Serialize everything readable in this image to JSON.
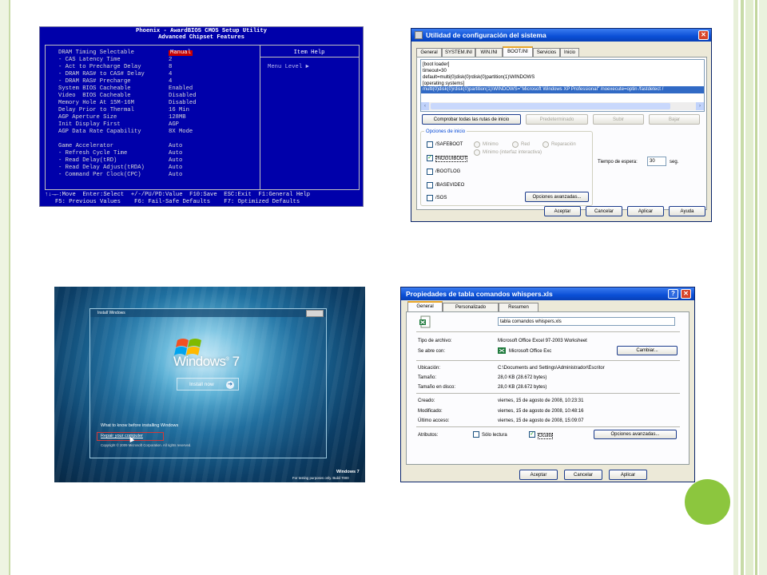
{
  "bios": {
    "title_line1": "Phoenix - AwardBIOS CMOS Setup Utility",
    "title_line2": "Advanced Chipset Features",
    "item_help_title": "Item Help",
    "menu_level": "Menu Level   ►",
    "rows": [
      {
        "label": "DRAM Timing Selectable",
        "value": "Manual"
      },
      {
        "label": "- CAS Latency Time",
        "value": "2"
      },
      {
        "label": "- Act to Precharge Delay",
        "value": "8"
      },
      {
        "label": "- DRAM RAS# to CAS# Delay",
        "value": "4"
      },
      {
        "label": "- DRAM RAS# Precharge",
        "value": "4"
      },
      {
        "label": "System BIOS Cacheable",
        "value": "Enabled"
      },
      {
        "label": "Video  BIOS Cacheable",
        "value": "Disabled"
      },
      {
        "label": "Memory Hole At 15M-16M",
        "value": "Disabled"
      },
      {
        "label": "Delay Prior to Thermal",
        "value": "16 Min"
      },
      {
        "label": "AGP Aperture Size",
        "value": "128MB"
      },
      {
        "label": "Init Display First",
        "value": "AGP"
      },
      {
        "label": "AGP Data Rate Capability",
        "value": "8X Mode"
      },
      {
        "label": "Game Accelerator",
        "value": "Auto"
      },
      {
        "label": "- Refresh Cycle Time",
        "value": "Auto"
      },
      {
        "label": "- Read Delay(tRD)",
        "value": "Auto"
      },
      {
        "label": "- Read Delay Adjust(tRDA)",
        "value": "Auto"
      },
      {
        "label": "- Command Per Clock(CPC)",
        "value": "Auto"
      }
    ],
    "footer_line1": "↑↓→←:Move  Enter:Select  +/-/PU/PD:Value  F10:Save  ESC:Exit  F1:General Help",
    "footer_line2": "   F5: Previous Values    F6: Fail-Safe Defaults    F7: Optimized Defaults"
  },
  "msconfig": {
    "title": "Utilidad de configuración del sistema",
    "tabs": [
      "General",
      "SYSTEM.INI",
      "WIN.INI",
      "BOOT.INI",
      "Servicios",
      "Inicio"
    ],
    "boot_lines": [
      "[boot loader]",
      "timeout=30",
      "default=multi(0)disk(0)rdisk(0)partition(1)\\WINDOWS",
      "[operating systems]",
      "multi(0)disk(0)rdisk(0)partition(1)\\WINDOWS=\"Microsoft Windows XP Professional\" /noexecute=optin /fastdetect /"
    ],
    "buttons_row": [
      "Comprobar todas las rutas de inicio",
      "Predeterminado",
      "Subir",
      "Bajar"
    ],
    "options_group": "Opciones de inicio",
    "options": [
      "/SAFEBOOT",
      "/NOGUIBOOT",
      "/BOOTLOG",
      "/BASEVIDEO",
      "/SOS"
    ],
    "radios": [
      "Mínimo",
      "Red",
      "Reparación",
      "Mínimo (interfaz interactiva)"
    ],
    "timeout_label": "Tiempo de espera:",
    "timeout_value": "30",
    "timeout_unit": "seg.",
    "advanced_button": "Opciones avanzadas...",
    "bottom_buttons": [
      "Aceptar",
      "Cancelar",
      "Aplicar",
      "Ayuda"
    ]
  },
  "win7": {
    "window_title": "Install Windows",
    "brand": "Windows",
    "brand_version": "7",
    "install_button": "Install now",
    "what_to_know": "What to know before installing Windows",
    "repair": "Repair your computer",
    "copyright": "Copyright © 2009 Microsoft Corporation. All rights reserved.",
    "watermark_line1": "Windows 7",
    "watermark_line2": "For testing purposes only. Build 7000"
  },
  "props": {
    "title": "Propiedades de tabla comandos whispers.xls",
    "tabs": [
      "General",
      "Personalizado",
      "Resumen"
    ],
    "filename": "tabla comandos whispers.xls",
    "rows": [
      {
        "label": "Tipo de archivo:",
        "value": "Microsoft Office Excel 97-2003 Worksheet"
      },
      {
        "label": "Se abre con:",
        "value": "Microsoft Office Exc"
      },
      {
        "label": "Ubicación:",
        "value": "C:\\Documents and Settings\\Administrador\\Escritor"
      },
      {
        "label": "Tamaño:",
        "value": "28,0 KB (28.672 bytes)"
      },
      {
        "label": "Tamaño en disco:",
        "value": "28,0 KB (28.672 bytes)"
      },
      {
        "label": "Creado:",
        "value": "viernes, 15 de agosto de 2008, 10:23:31"
      },
      {
        "label": "Modificado:",
        "value": "viernes, 15 de agosto de 2008, 10:48:16"
      },
      {
        "label": "Último acceso:",
        "value": "viernes, 15 de agosto de 2008, 15:09:07"
      }
    ],
    "change_button": "Cambiar...",
    "attributes_label": "Atributos:",
    "readonly_label": "Sólo lectura",
    "hidden_label": "Oculto",
    "advanced_button": "Opciones avanzadas...",
    "bottom_buttons": [
      "Aceptar",
      "Cancelar",
      "Aplicar"
    ]
  },
  "colors": {
    "bios_bg": "#0000aa",
    "xp_title": "#0a4fd6",
    "accent_green": "#8cc63e"
  }
}
